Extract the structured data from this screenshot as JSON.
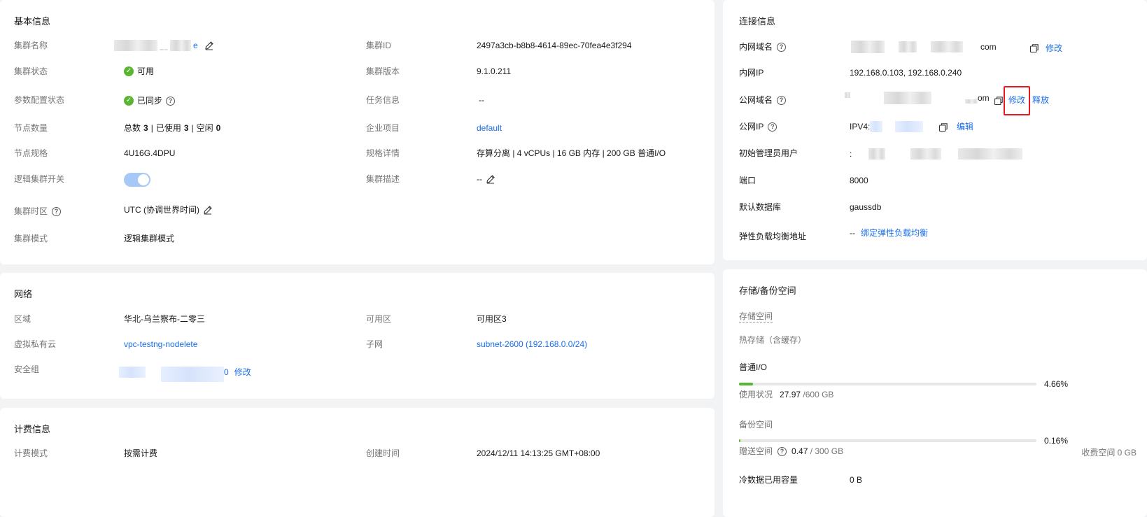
{
  "basic_info": {
    "title": "基本信息",
    "cluster_name_label": "集群名称",
    "cluster_name_suffix": "e",
    "cluster_status_label": "集群状态",
    "cluster_status_value": "可用",
    "param_status_label": "参数配置状态",
    "param_status_value": "已同步",
    "node_count_label": "节点数量",
    "node_total_label": "总数",
    "node_total": "3",
    "node_used_label": "已使用",
    "node_used": "3",
    "node_idle_label": "空闲",
    "node_idle": "0",
    "node_sep": "|",
    "node_spec_label": "节点规格",
    "node_spec_value": "4U16G.4DPU",
    "logic_switch_label": "逻辑集群开关",
    "timezone_label": "集群时区",
    "timezone_value": "UTC (协调世界时间)",
    "mode_label": "集群模式",
    "mode_value": "逻辑集群模式",
    "cluster_id_label": "集群ID",
    "cluster_id_value": "2497a3cb-b8b8-4614-89ec-70fea4e3f294",
    "version_label": "集群版本",
    "version_value": "9.1.0.211",
    "task_label": "任务信息",
    "task_value": "--",
    "enterprise_label": "企业项目",
    "enterprise_value": "default",
    "spec_detail_label": "规格详情",
    "spec_detail_value": "存算分离 | 4 vCPUs | 16 GB 内存 | 200 GB 普通I/O",
    "desc_label": "集群描述",
    "desc_value": "--"
  },
  "network": {
    "title": "网络",
    "region_label": "区域",
    "region_value": "华北-乌兰察布-二零三",
    "vpc_label": "虚拟私有云",
    "vpc_value": "vpc-testng-nodelete",
    "sg_label": "安全组",
    "sg_suffix": "0",
    "sg_modify": "修改",
    "az_label": "可用区",
    "az_value": "可用区3",
    "subnet_label": "子网",
    "subnet_value": "subnet-2600 (192.168.0.0/24)"
  },
  "billing": {
    "title": "计费信息",
    "mode_label": "计费模式",
    "mode_value": "按需计费",
    "created_label": "创建时间",
    "created_value": "2024/12/11 14:13:25 GMT+08:00"
  },
  "connection": {
    "title": "连接信息",
    "private_domain_label": "内网域名",
    "private_domain_suffix": "com",
    "private_domain_modify": "修改",
    "private_ip_label": "内网IP",
    "private_ip_value": "192.168.0.103, 192.168.0.240",
    "public_domain_label": "公网域名",
    "public_domain_suffix": "om",
    "public_domain_modify": "修改",
    "public_domain_release": "释放",
    "public_ip_label": "公网IP",
    "public_ip_prefix": "IPV4:",
    "public_ip_edit": "编辑",
    "admin_label": "初始管理员用户",
    "admin_prefix": ":",
    "port_label": "端口",
    "port_value": "8000",
    "db_label": "默认数据库",
    "db_value": "gaussdb",
    "elb_label": "弹性负载均衡地址",
    "elb_value": "--",
    "elb_bind": "绑定弹性负载均衡"
  },
  "storage": {
    "title": "存储/备份空间",
    "storage_space_label": "存储空间",
    "hot_storage_label": "热存储（含缓存）",
    "normal_io_label": "普通I/O",
    "normal_io_pct": "4.66%",
    "normal_io_fraction": 0.0466,
    "usage_label": "使用状况",
    "usage_used": "27.97",
    "usage_total": "/600 GB",
    "backup_label": "备份空间",
    "backup_pct": "0.16%",
    "backup_fraction": 0.0016,
    "free_label": "赠送空间",
    "free_used": "0.47",
    "free_total": "/ 300 GB",
    "charged_label": "收费空间 0 GB",
    "cold_label": "冷数据已用容量",
    "cold_value": "0 B"
  },
  "colors": {
    "link": "#1a6ee8",
    "success": "#5ab532",
    "highlight": "#e8191e"
  }
}
